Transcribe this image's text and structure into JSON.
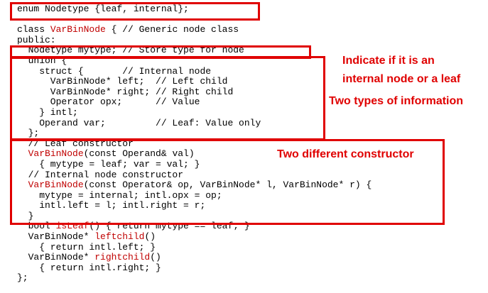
{
  "colors": {
    "highlight": "#c00000",
    "box": "#e00000",
    "annotation": "#e00000"
  },
  "code_lines": [
    [
      {
        "t": "enum Nodetype {leaf, internal};",
        "c": "black"
      }
    ],
    [
      {
        "t": "",
        "c": "black"
      }
    ],
    [
      {
        "t": "class ",
        "c": "black"
      },
      {
        "t": "VarBinNode",
        "c": "red"
      },
      {
        "t": " { // Generic node class",
        "c": "black"
      }
    ],
    [
      {
        "t": "public:",
        "c": "black"
      }
    ],
    [
      {
        "t": "  Nodetype mytype; // Store type for node",
        "c": "black"
      }
    ],
    [
      {
        "t": "  union {",
        "c": "black"
      }
    ],
    [
      {
        "t": "    struct {       // Internal node",
        "c": "black"
      }
    ],
    [
      {
        "t": "      VarBinNode* left;  // Left child",
        "c": "black"
      }
    ],
    [
      {
        "t": "      VarBinNode* right; // Right child",
        "c": "black"
      }
    ],
    [
      {
        "t": "      Operator opx;      // Value",
        "c": "black"
      }
    ],
    [
      {
        "t": "    } intl;",
        "c": "black"
      }
    ],
    [
      {
        "t": "    Operand var;         // Leaf: Value only",
        "c": "black"
      }
    ],
    [
      {
        "t": "  };",
        "c": "black"
      }
    ],
    [
      {
        "t": "  // Leaf constructor",
        "c": "black"
      }
    ],
    [
      {
        "t": "  ",
        "c": "black"
      },
      {
        "t": "VarBinNode",
        "c": "red"
      },
      {
        "t": "(const Operand& val)",
        "c": "black"
      }
    ],
    [
      {
        "t": "    { mytype = leaf; var = val; }",
        "c": "black"
      }
    ],
    [
      {
        "t": "  // Internal node constructor",
        "c": "black"
      }
    ],
    [
      {
        "t": "  ",
        "c": "black"
      },
      {
        "t": "VarBinNode",
        "c": "red"
      },
      {
        "t": "(const Operator& op, VarBinNode* l, VarBinNode* r) {",
        "c": "black"
      }
    ],
    [
      {
        "t": "    mytype = internal; intl.opx = op;",
        "c": "black"
      }
    ],
    [
      {
        "t": "    intl.left = l; intl.right = r;",
        "c": "black"
      }
    ],
    [
      {
        "t": "  }",
        "c": "black"
      }
    ],
    [
      {
        "t": "  bool ",
        "c": "black"
      },
      {
        "t": "isLeaf",
        "c": "red"
      },
      {
        "t": "() { return mytype == leaf; }",
        "c": "black"
      }
    ],
    [
      {
        "t": "  VarBinNode* ",
        "c": "black"
      },
      {
        "t": "leftchild",
        "c": "red"
      },
      {
        "t": "()",
        "c": "black"
      }
    ],
    [
      {
        "t": "    { return intl.left; }",
        "c": "black"
      }
    ],
    [
      {
        "t": "  VarBinNode* ",
        "c": "black"
      },
      {
        "t": "rightchild",
        "c": "red"
      },
      {
        "t": "()",
        "c": "black"
      }
    ],
    [
      {
        "t": "    { return intl.right; }",
        "c": "black"
      }
    ],
    [
      {
        "t": "};",
        "c": "black"
      }
    ]
  ],
  "annotations": {
    "node_indicator": {
      "line1": "Indicate if it is an",
      "line2": "internal node or a leaf"
    },
    "info_types": "Two types of information",
    "constructors": "Two different constructor"
  }
}
